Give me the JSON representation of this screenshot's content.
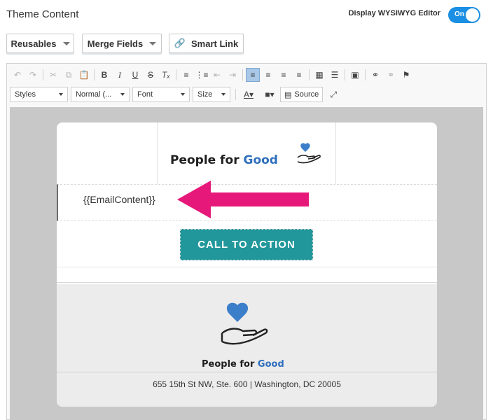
{
  "header": {
    "title": "Theme Content",
    "wysiwyg_label": "Display WYSIWYG Editor",
    "toggle_state": "On"
  },
  "buttons": {
    "reusables": "Reusables",
    "merge_fields": "Merge Fields",
    "smart_link": "Smart Link"
  },
  "toolbar": {
    "styles": "Styles",
    "format": "Normal (...",
    "font": "Font",
    "size": "Size",
    "source": "Source",
    "row1_icons": [
      "undo-icon",
      "redo-icon",
      "cut-icon",
      "copy-icon",
      "paste-icon",
      "bold-icon",
      "italic-icon",
      "underline-icon",
      "strike-icon",
      "remove-format-icon",
      "numbered-list-icon",
      "bulleted-list-icon",
      "outdent-icon",
      "indent-icon",
      "align-left-icon",
      "align-center-icon",
      "align-right-icon",
      "justify-icon",
      "table-icon",
      "horizontal-rule-icon",
      "image-icon",
      "link-icon",
      "unlink-icon",
      "anchor-icon"
    ]
  },
  "email": {
    "brand_name_part1": "People for ",
    "brand_name_part2": "Good",
    "content_placeholder": "{{EmailContent}}",
    "cta_label": "CALL TO ACTION",
    "address": "655 15th St NW, Ste. 600 | Washington, DC 20005"
  },
  "colors": {
    "accent": "#1a8fe3",
    "cta": "#21979b",
    "arrow": "#e6197a",
    "brand_blue": "#2f6fbd"
  }
}
